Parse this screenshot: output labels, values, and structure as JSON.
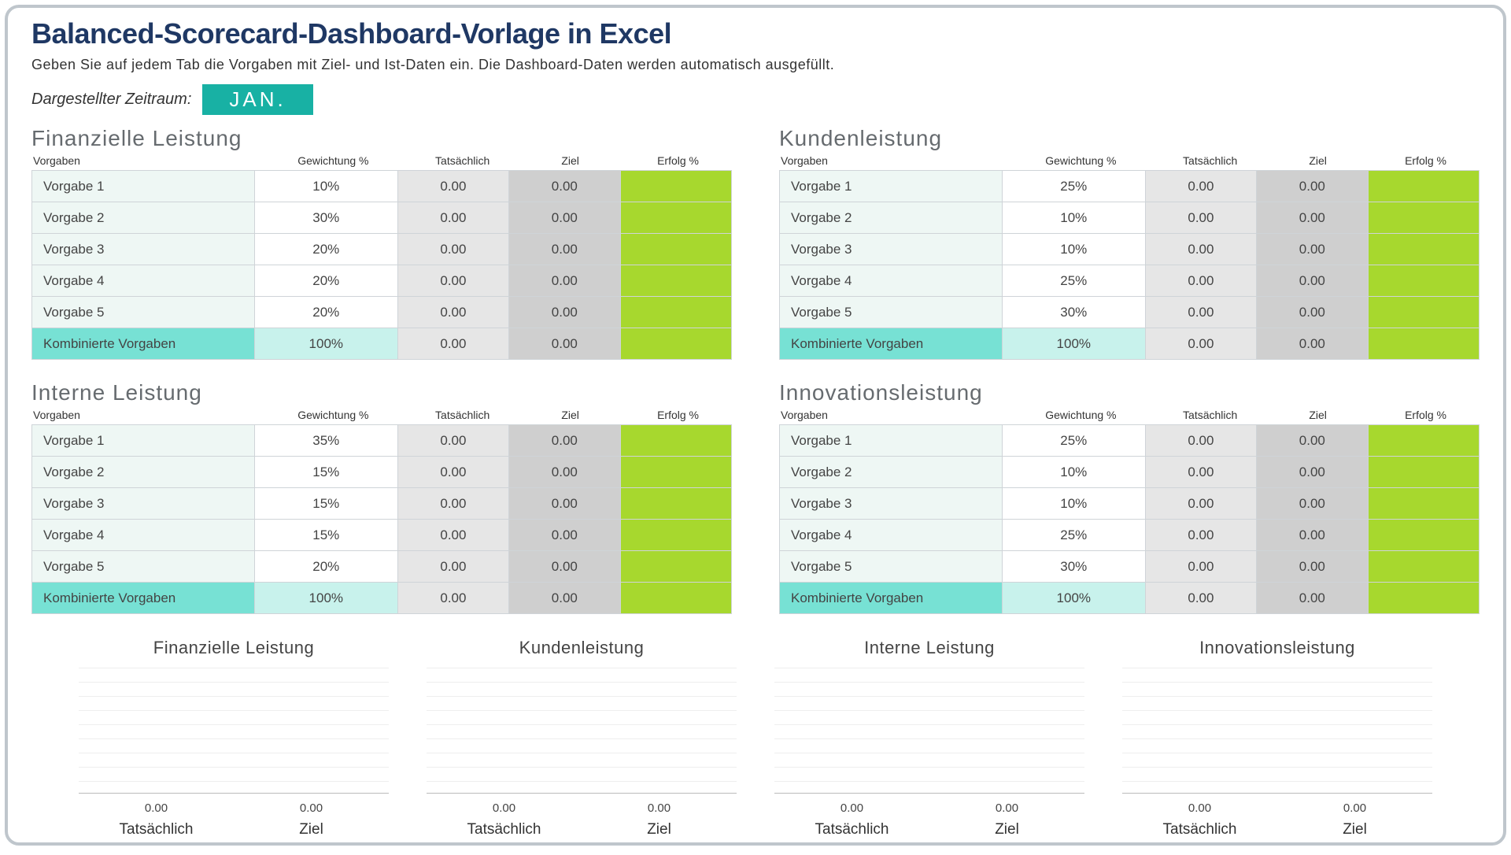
{
  "title": "Balanced-Scorecard-Dashboard-Vorlage in Excel",
  "subtitle": "Geben Sie auf jedem Tab die Vorgaben mit Ziel- und Ist-Daten ein. Die Dashboard-Daten werden automatisch ausgefüllt.",
  "period_label": "Dargestellter Zeitraum:",
  "period_value": "JAN.",
  "headers": {
    "vorgaben": "Vorgaben",
    "gewicht": "Gewichtung %",
    "tat": "Tatsächlich",
    "ziel": "Ziel",
    "erfolg": "Erfolg %"
  },
  "total_label": "Kombinierte Vorgaben",
  "panels": [
    {
      "title": "Finanzielle Leistung",
      "rows": [
        {
          "name": "Vorgabe 1",
          "weight": "10%",
          "act": "0.00",
          "tgt": "0.00"
        },
        {
          "name": "Vorgabe 2",
          "weight": "30%",
          "act": "0.00",
          "tgt": "0.00"
        },
        {
          "name": "Vorgabe 3",
          "weight": "20%",
          "act": "0.00",
          "tgt": "0.00"
        },
        {
          "name": "Vorgabe 4",
          "weight": "20%",
          "act": "0.00",
          "tgt": "0.00"
        },
        {
          "name": "Vorgabe 5",
          "weight": "20%",
          "act": "0.00",
          "tgt": "0.00"
        }
      ],
      "total": {
        "weight": "100%",
        "act": "0.00",
        "tgt": "0.00"
      }
    },
    {
      "title": "Kundenleistung",
      "rows": [
        {
          "name": "Vorgabe 1",
          "weight": "25%",
          "act": "0.00",
          "tgt": "0.00"
        },
        {
          "name": "Vorgabe 2",
          "weight": "10%",
          "act": "0.00",
          "tgt": "0.00"
        },
        {
          "name": "Vorgabe 3",
          "weight": "10%",
          "act": "0.00",
          "tgt": "0.00"
        },
        {
          "name": "Vorgabe 4",
          "weight": "25%",
          "act": "0.00",
          "tgt": "0.00"
        },
        {
          "name": "Vorgabe 5",
          "weight": "30%",
          "act": "0.00",
          "tgt": "0.00"
        }
      ],
      "total": {
        "weight": "100%",
        "act": "0.00",
        "tgt": "0.00"
      }
    },
    {
      "title": "Interne Leistung",
      "rows": [
        {
          "name": "Vorgabe 1",
          "weight": "35%",
          "act": "0.00",
          "tgt": "0.00"
        },
        {
          "name": "Vorgabe 2",
          "weight": "15%",
          "act": "0.00",
          "tgt": "0.00"
        },
        {
          "name": "Vorgabe 3",
          "weight": "15%",
          "act": "0.00",
          "tgt": "0.00"
        },
        {
          "name": "Vorgabe 4",
          "weight": "15%",
          "act": "0.00",
          "tgt": "0.00"
        },
        {
          "name": "Vorgabe 5",
          "weight": "20%",
          "act": "0.00",
          "tgt": "0.00"
        }
      ],
      "total": {
        "weight": "100%",
        "act": "0.00",
        "tgt": "0.00"
      }
    },
    {
      "title": "Innovationsleistung",
      "rows": [
        {
          "name": "Vorgabe 1",
          "weight": "25%",
          "act": "0.00",
          "tgt": "0.00"
        },
        {
          "name": "Vorgabe 2",
          "weight": "10%",
          "act": "0.00",
          "tgt": "0.00"
        },
        {
          "name": "Vorgabe 3",
          "weight": "10%",
          "act": "0.00",
          "tgt": "0.00"
        },
        {
          "name": "Vorgabe 4",
          "weight": "25%",
          "act": "0.00",
          "tgt": "0.00"
        },
        {
          "name": "Vorgabe 5",
          "weight": "30%",
          "act": "0.00",
          "tgt": "0.00"
        }
      ],
      "total": {
        "weight": "100%",
        "act": "0.00",
        "tgt": "0.00"
      }
    }
  ],
  "chart_axis": {
    "actual_lbl": "Tatsächlich",
    "target_lbl": "Ziel",
    "actual_val": "0.00",
    "target_val": "0.00"
  },
  "chart_data": [
    {
      "type": "bar",
      "title": "Finanzielle Leistung",
      "categories": [
        "Tatsächlich",
        "Ziel"
      ],
      "values": [
        0.0,
        0.0
      ],
      "ylim": [
        0,
        1
      ]
    },
    {
      "type": "bar",
      "title": "Kundenleistung",
      "categories": [
        "Tatsächlich",
        "Ziel"
      ],
      "values": [
        0.0,
        0.0
      ],
      "ylim": [
        0,
        1
      ]
    },
    {
      "type": "bar",
      "title": "Interne Leistung",
      "categories": [
        "Tatsächlich",
        "Ziel"
      ],
      "values": [
        0.0,
        0.0
      ],
      "ylim": [
        0,
        1
      ]
    },
    {
      "type": "bar",
      "title": "Innovationsleistung",
      "categories": [
        "Tatsächlich",
        "Ziel"
      ],
      "values": [
        0.0,
        0.0
      ],
      "ylim": [
        0,
        1
      ]
    }
  ]
}
